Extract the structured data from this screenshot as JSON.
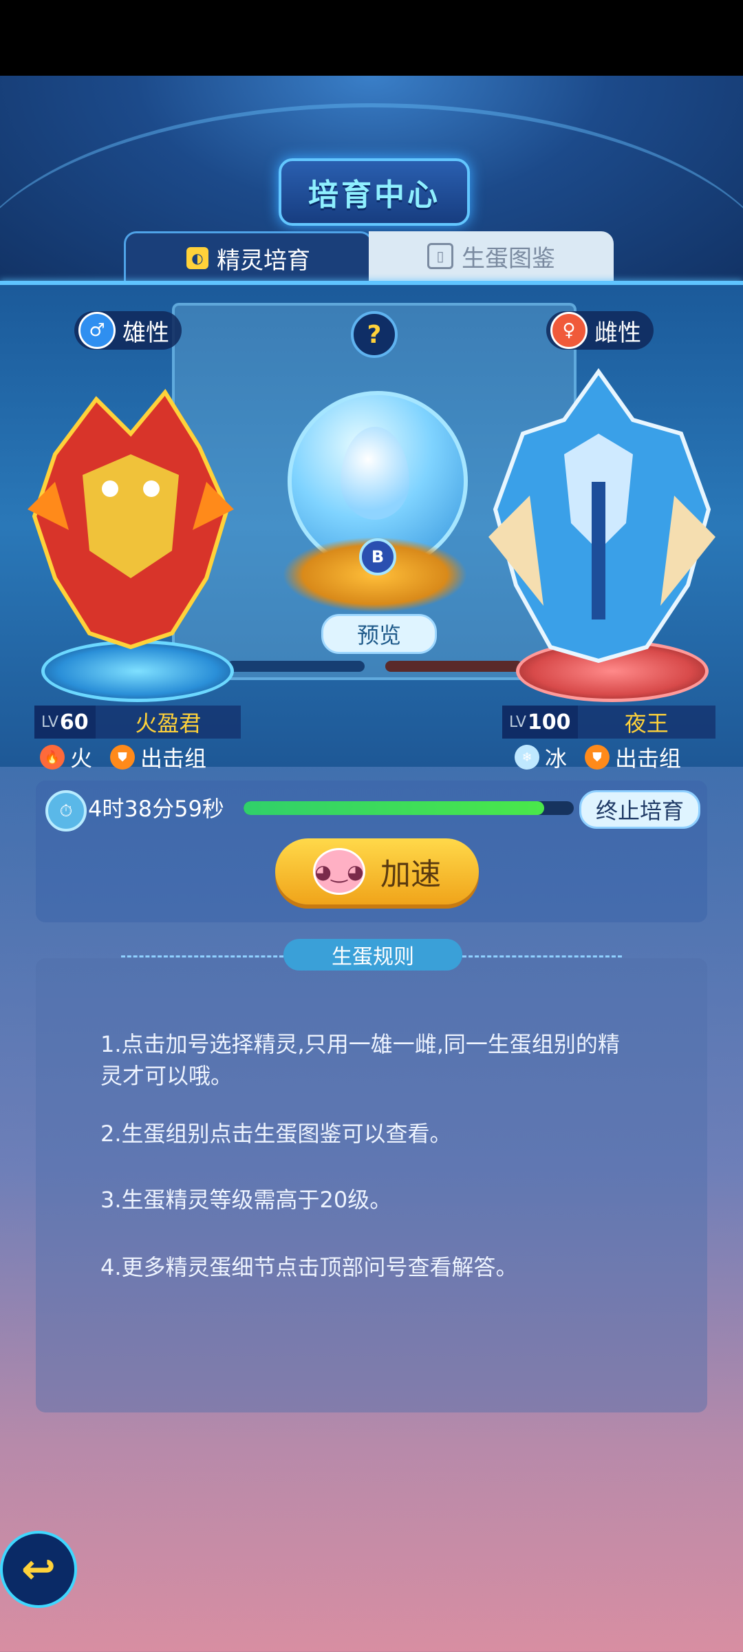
{
  "header": {
    "title": "培育中心"
  },
  "tabs": [
    {
      "label": "精灵培育",
      "active": true
    },
    {
      "label": "生蛋图鉴",
      "active": false
    }
  ],
  "male": {
    "gender_label": "雄性",
    "level_prefix": "LV",
    "level": "60",
    "name": "火盈君",
    "element": "火",
    "group": "出击组"
  },
  "female": {
    "gender_label": "雌性",
    "level_prefix": "LV",
    "level": "100",
    "name": "夜王",
    "element": "冰",
    "group": "出击组"
  },
  "help": {
    "label": "?"
  },
  "egg": {
    "badge": "B",
    "preview_label": "预览"
  },
  "breeding": {
    "time_remaining": "4时38分59秒",
    "progress": 0.91,
    "stop_label": "终止培育",
    "speed_label": "加速"
  },
  "rules": {
    "title": "生蛋规则",
    "items": [
      "1.点击加号选择精灵,只用一雄一雌,同一生蛋组别的精灵才可以哦。",
      "2.生蛋组别点击生蛋图鉴可以查看。",
      "3.生蛋精灵等级需高于20级。",
      "4.更多精灵蛋细节点击顶部问号查看解答。"
    ]
  },
  "colors": {
    "accent": "#ffd23a",
    "cyan": "#5fc4ff",
    "progress": "#30d06a"
  }
}
